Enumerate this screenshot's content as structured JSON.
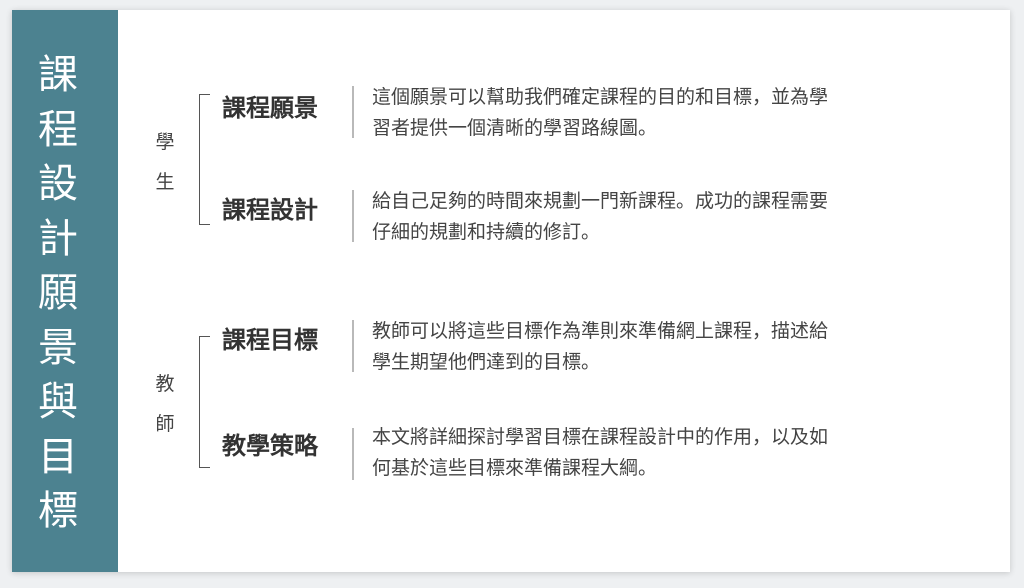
{
  "side": {
    "title_chars": [
      "課",
      "程",
      "設",
      "計",
      "願",
      "景",
      "與",
      "目",
      "標"
    ]
  },
  "groups": [
    {
      "label_chars": [
        "學",
        "生"
      ]
    },
    {
      "label_chars": [
        "教",
        "師"
      ]
    }
  ],
  "items": [
    {
      "title": "課程願景",
      "desc_lines": [
        "這個願景可以幫助我們確定課程的目的和目標，並為學",
        "習者提供一個清晰的學習路線圖。"
      ]
    },
    {
      "title": "課程設計",
      "desc_lines": [
        "給自己足夠的時間來規劃一門新課程。成功的課程需要",
        "仔細的規劃和持續的修訂。"
      ]
    },
    {
      "title": "課程目標",
      "desc_lines": [
        "教師可以將這些目標作為準則來準備網上課程，描述給",
        "學生期望他們達到的目標。"
      ]
    },
    {
      "title": "教學策略",
      "desc_lines": [
        "本文將詳細探討學習目標在課程設計中的作用，以及如",
        "何基於這些目標來準備課程大綱。"
      ]
    }
  ],
  "colors": {
    "side_panel": "#4c8290",
    "title_text": "#333333",
    "desc_text": "#444444"
  }
}
